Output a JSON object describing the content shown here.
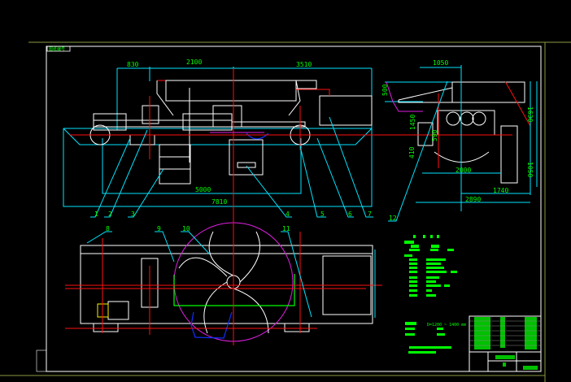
{
  "drawing": {
    "tag": "图纸编号",
    "colors": {
      "background": "#000000",
      "outline": "#ffffff",
      "dimension": "#00e5ff",
      "centerline": "#ff1010",
      "text": "#00ff00",
      "accent": "#e020e0"
    },
    "front_view": {
      "dims": {
        "d1": "830",
        "d2": "2100",
        "d3": "3510",
        "d4": "5000",
        "d5": "7810"
      },
      "labels": [
        "1",
        "2",
        "3",
        "4",
        "5",
        "6",
        "7"
      ]
    },
    "side_view": {
      "dims": {
        "d1": "1050",
        "d2": "500",
        "d3": "1450",
        "d4": "590",
        "d5": "410",
        "d6": "2000",
        "d7": "1740",
        "d8": "2890",
        "d9": "1630",
        "d10": "1050"
      },
      "labels": [
        "12"
      ]
    },
    "plan_view": {
      "labels": [
        "8",
        "9",
        "10",
        "11"
      ]
    },
    "notes": {
      "line1": "D=1200 ~ 1400 mm"
    }
  }
}
